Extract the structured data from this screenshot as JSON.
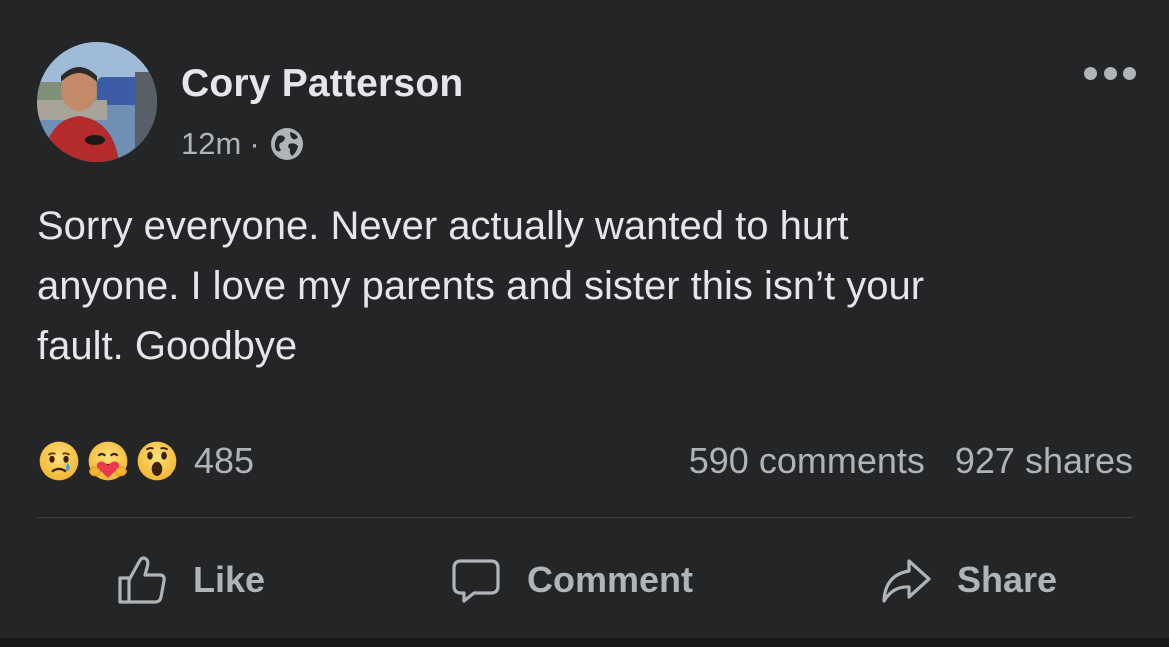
{
  "post": {
    "author": "Cory Patterson",
    "time": "12m",
    "separator": "·",
    "audience_icon": "globe-icon",
    "text": "Sorry everyone.  Never actually wanted to hurt\nanyone.   I love my parents and sister this isn’t your\nfault.  Goodbye"
  },
  "reactions": {
    "icons": [
      "sad-reaction-icon",
      "care-reaction-icon",
      "wow-reaction-icon"
    ],
    "count": "485"
  },
  "stats": {
    "comments": "590 comments",
    "shares": "927 shares"
  },
  "actions": {
    "like_label": "Like",
    "comment_label": "Comment",
    "share_label": "Share"
  },
  "colors": {
    "background": "#242526",
    "primary_text": "#e4e6eb",
    "secondary_text": "#b0b3b8",
    "divider": "#3e4042"
  }
}
